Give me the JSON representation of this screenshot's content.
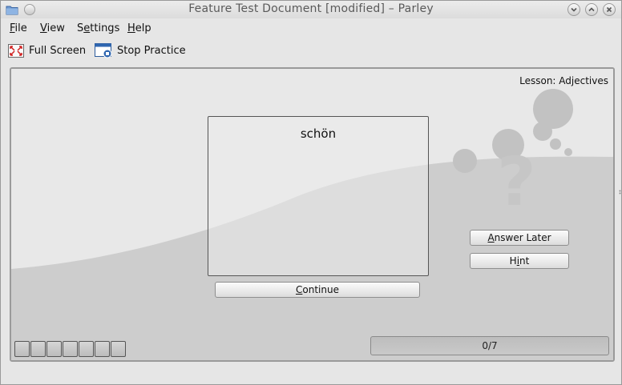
{
  "window": {
    "title": "Feature Test Document [modified] – Parley"
  },
  "titlebar": {
    "icons": {
      "app": "folder-icon",
      "minimize": "chevron-down-icon",
      "maximize": "chevron-up-icon",
      "close": "close-icon"
    }
  },
  "menubar": {
    "items": [
      "File",
      "View",
      "Settings",
      "Help"
    ]
  },
  "toolbar": {
    "full_screen": {
      "label": "Full Screen",
      "icon": "fullscreen-icon"
    },
    "stop_practice": {
      "label": "Stop Practice",
      "icon": "stop-practice-icon"
    }
  },
  "practice": {
    "lesson_label": "Lesson: Adjectives",
    "card_word": "schön",
    "continue_label": "Continue",
    "answer_later_label": "Answer Later",
    "hint_label": "Hint",
    "progress_text": "0/7",
    "progress_fraction": 0,
    "squares_count": 7
  },
  "colors": {
    "background": "#e8e8e8",
    "wave": "#cdcdcd",
    "decor": "#c4c4c4"
  }
}
